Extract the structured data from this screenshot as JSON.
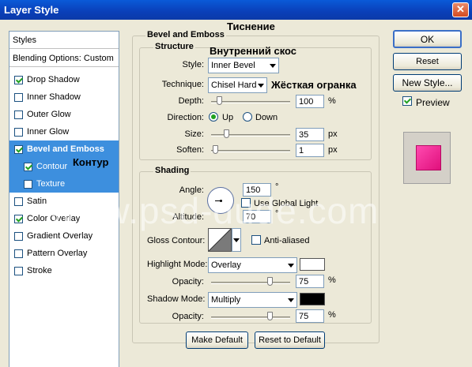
{
  "window": {
    "title": "Layer Style",
    "close_glyph": "✕"
  },
  "annotations": {
    "bevel_emboss": "Тиснение",
    "inner_bevel": "Внутренний скос",
    "chisel_hard": "Жёсткая огранка",
    "contour": "Контур"
  },
  "watermark": "www.psd-dude.com",
  "styles_panel": {
    "header": "Styles",
    "blending": "Blending Options: Custom",
    "items": [
      {
        "label": "Drop Shadow",
        "checked": true
      },
      {
        "label": "Inner Shadow",
        "checked": false
      },
      {
        "label": "Outer Glow",
        "checked": false
      },
      {
        "label": "Inner Glow",
        "checked": false
      },
      {
        "label": "Bevel and Emboss",
        "checked": true
      },
      {
        "label": "Contour",
        "checked": true
      },
      {
        "label": "Texture",
        "checked": false
      },
      {
        "label": "Satin",
        "checked": false
      },
      {
        "label": "Color Overlay",
        "checked": true
      },
      {
        "label": "Gradient Overlay",
        "checked": false
      },
      {
        "label": "Pattern Overlay",
        "checked": false
      },
      {
        "label": "Stroke",
        "checked": false
      }
    ]
  },
  "bevel": {
    "group_title": "Bevel and Emboss",
    "structure_title": "Structure",
    "style_label": "Style:",
    "style_value": "Inner Bevel",
    "technique_label": "Technique:",
    "technique_value": "Chisel Hard",
    "depth_label": "Depth:",
    "depth_value": "100",
    "depth_unit": "%",
    "direction_label": "Direction:",
    "dir_up": "Up",
    "dir_down": "Down",
    "size_label": "Size:",
    "size_value": "35",
    "size_unit": "px",
    "soften_label": "Soften:",
    "soften_value": "1",
    "soften_unit": "px"
  },
  "shading": {
    "title": "Shading",
    "angle_label": "Angle:",
    "angle_value": "150",
    "angle_unit": "°",
    "global_light": "Use Global Light",
    "altitude_label": "Altitude:",
    "altitude_value": "70",
    "altitude_unit": "°",
    "gloss_label": "Gloss Contour:",
    "anti_aliased": "Anti-aliased",
    "highlight_label": "Highlight Mode:",
    "highlight_value": "Overlay",
    "highlight_color": "#ffffff",
    "hl_opacity_label": "Opacity:",
    "hl_opacity_value": "75",
    "hl_opacity_unit": "%",
    "shadow_label": "Shadow Mode:",
    "shadow_value": "Multiply",
    "shadow_color": "#000000",
    "sh_opacity_label": "Opacity:",
    "sh_opacity_value": "75",
    "sh_opacity_unit": "%"
  },
  "buttons": {
    "make_default": "Make Default",
    "reset_default": "Reset to Default",
    "ok": "OK",
    "reset": "Reset",
    "new_style": "New Style...",
    "preview": "Preview"
  },
  "accent_color": "#3d8fde",
  "preview_color": "#ff2d9b"
}
